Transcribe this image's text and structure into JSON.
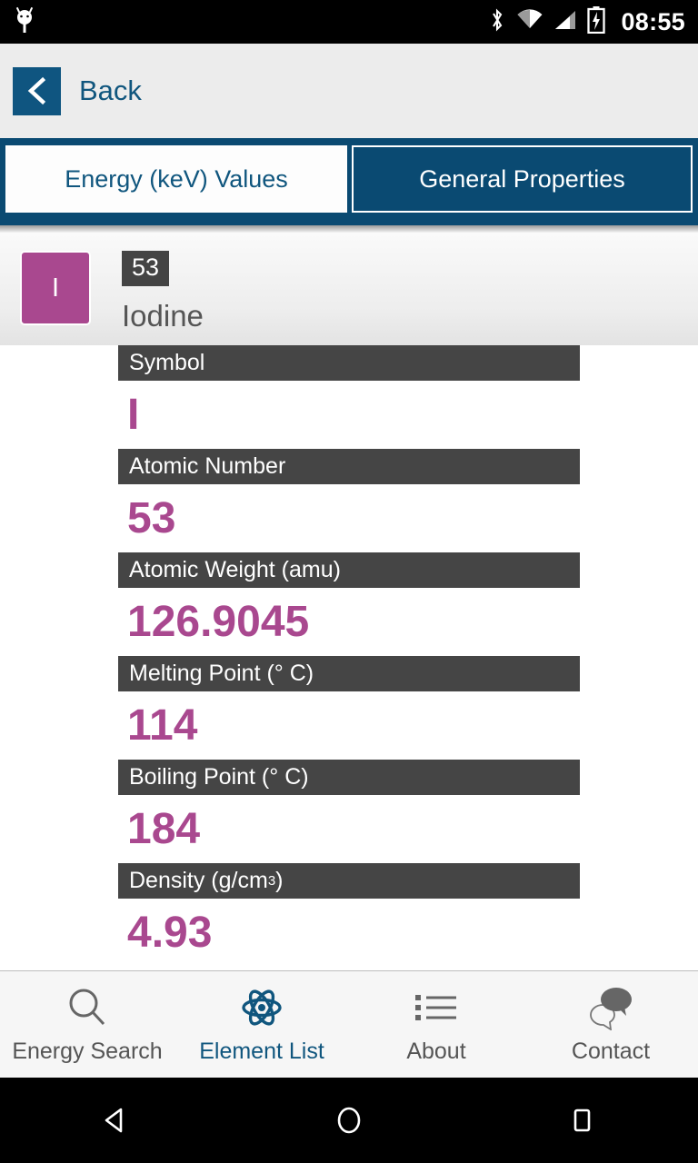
{
  "statusbar": {
    "notification_icon": "android-robot-icon",
    "icons": [
      "bluetooth-icon",
      "wifi-icon",
      "cellular-signal-icon",
      "battery-charging-icon"
    ],
    "clock": "08:55"
  },
  "navbar": {
    "back_label": "Back",
    "back_icon": "chevron-left-icon"
  },
  "tabs": [
    {
      "label": "Energy (keV) Values",
      "active": false
    },
    {
      "label": "General Properties",
      "active": true
    }
  ],
  "element": {
    "symbol": "I",
    "atomic_number": "53",
    "name": "Iodine",
    "tile_color": "#a9488f"
  },
  "properties": [
    {
      "label": "Symbol",
      "value": "I",
      "sup": ""
    },
    {
      "label": "Atomic Number",
      "value": "53",
      "sup": ""
    },
    {
      "label": "Atomic Weight (amu)",
      "value": "126.9045",
      "sup": ""
    },
    {
      "label": "Melting Point (° C)",
      "value": "114",
      "sup": ""
    },
    {
      "label": "Boiling Point (° C)",
      "value": "184",
      "sup": ""
    },
    {
      "label": "Density (g/cm",
      "value": "4.93",
      "sup": "3"
    }
  ],
  "bottom_nav": [
    {
      "label": "Energy Search",
      "icon": "search-icon",
      "active": false
    },
    {
      "label": "Element List",
      "icon": "atom-icon",
      "active": true
    },
    {
      "label": "About",
      "icon": "list-icon",
      "active": false
    },
    {
      "label": "Contact",
      "icon": "chat-bubbles-icon",
      "active": false
    }
  ],
  "android_nav": [
    {
      "name": "back-triangle-icon"
    },
    {
      "name": "home-circle-icon"
    },
    {
      "name": "recents-square-icon"
    }
  ],
  "colors": {
    "brand_blue": "#0a4a72",
    "accent_purple": "#a9488f",
    "label_gray": "#454545"
  }
}
